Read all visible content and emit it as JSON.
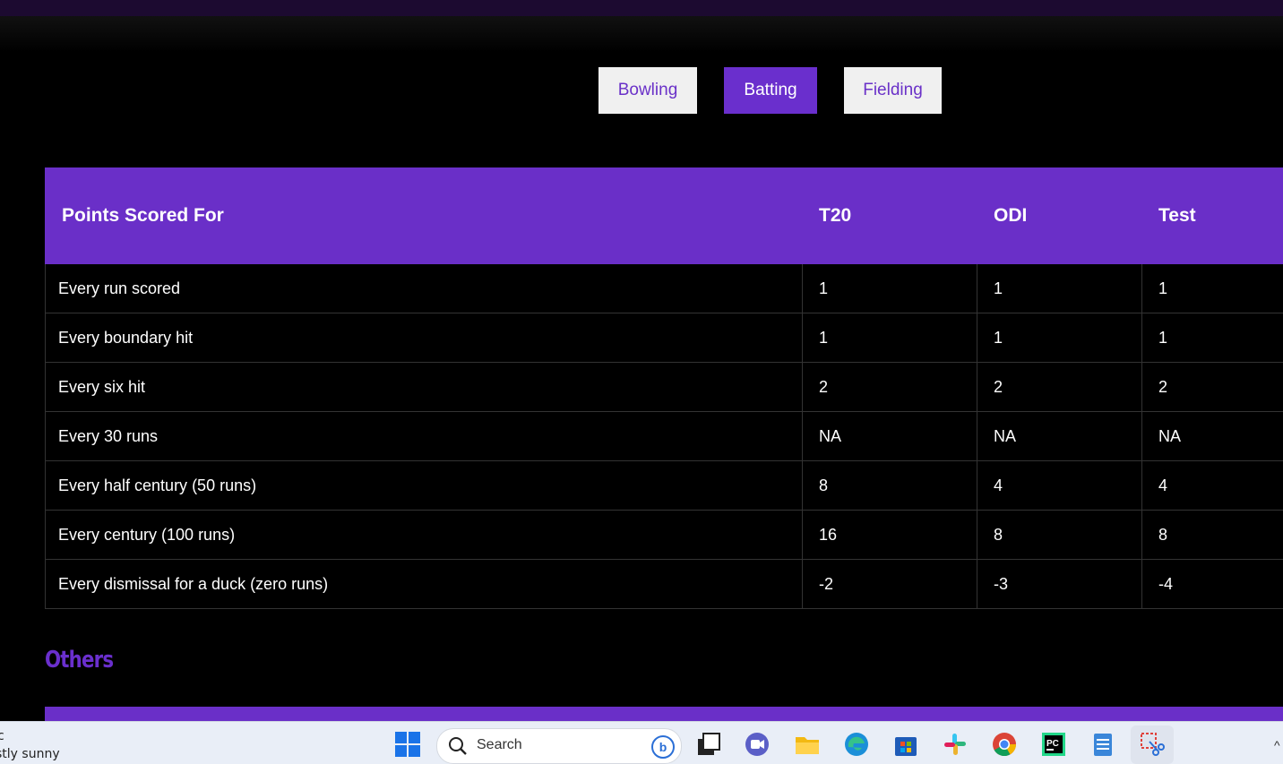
{
  "tabs": {
    "bowling": "Bowling",
    "batting": "Batting",
    "fielding": "Fielding",
    "active": "Batting"
  },
  "table": {
    "headers": [
      "Points Scored For",
      "T20",
      "ODI",
      "Test"
    ],
    "rows": [
      [
        "Every run scored",
        "1",
        "1",
        "1"
      ],
      [
        "Every boundary hit",
        "1",
        "1",
        "1"
      ],
      [
        "Every six hit",
        "2",
        "2",
        "2"
      ],
      [
        "Every 30 runs",
        "NA",
        "NA",
        "NA"
      ],
      [
        "Every half century (50 runs)",
        "8",
        "4",
        "4"
      ],
      [
        "Every century (100 runs)",
        "16",
        "8",
        "8"
      ],
      [
        "Every dismissal for a duck (zero runs)",
        "-2",
        "-3",
        "-4"
      ]
    ]
  },
  "sections": {
    "others_heading": "Others"
  },
  "taskbar": {
    "weather_temp": "c",
    "weather_condition": "stly sunny",
    "search_placeholder": "Search",
    "apps": [
      "windows-start",
      "search",
      "bing",
      "task-view",
      "teams-meet",
      "file-explorer",
      "edge",
      "store",
      "slack",
      "chrome",
      "pycharm",
      "notepad",
      "snipping-tool"
    ]
  },
  "colors": {
    "accent": "#6a2fcd",
    "background": "#000000",
    "tab_inactive_bg": "#f0f0f0",
    "taskbar_bg": "#e9eef7"
  }
}
